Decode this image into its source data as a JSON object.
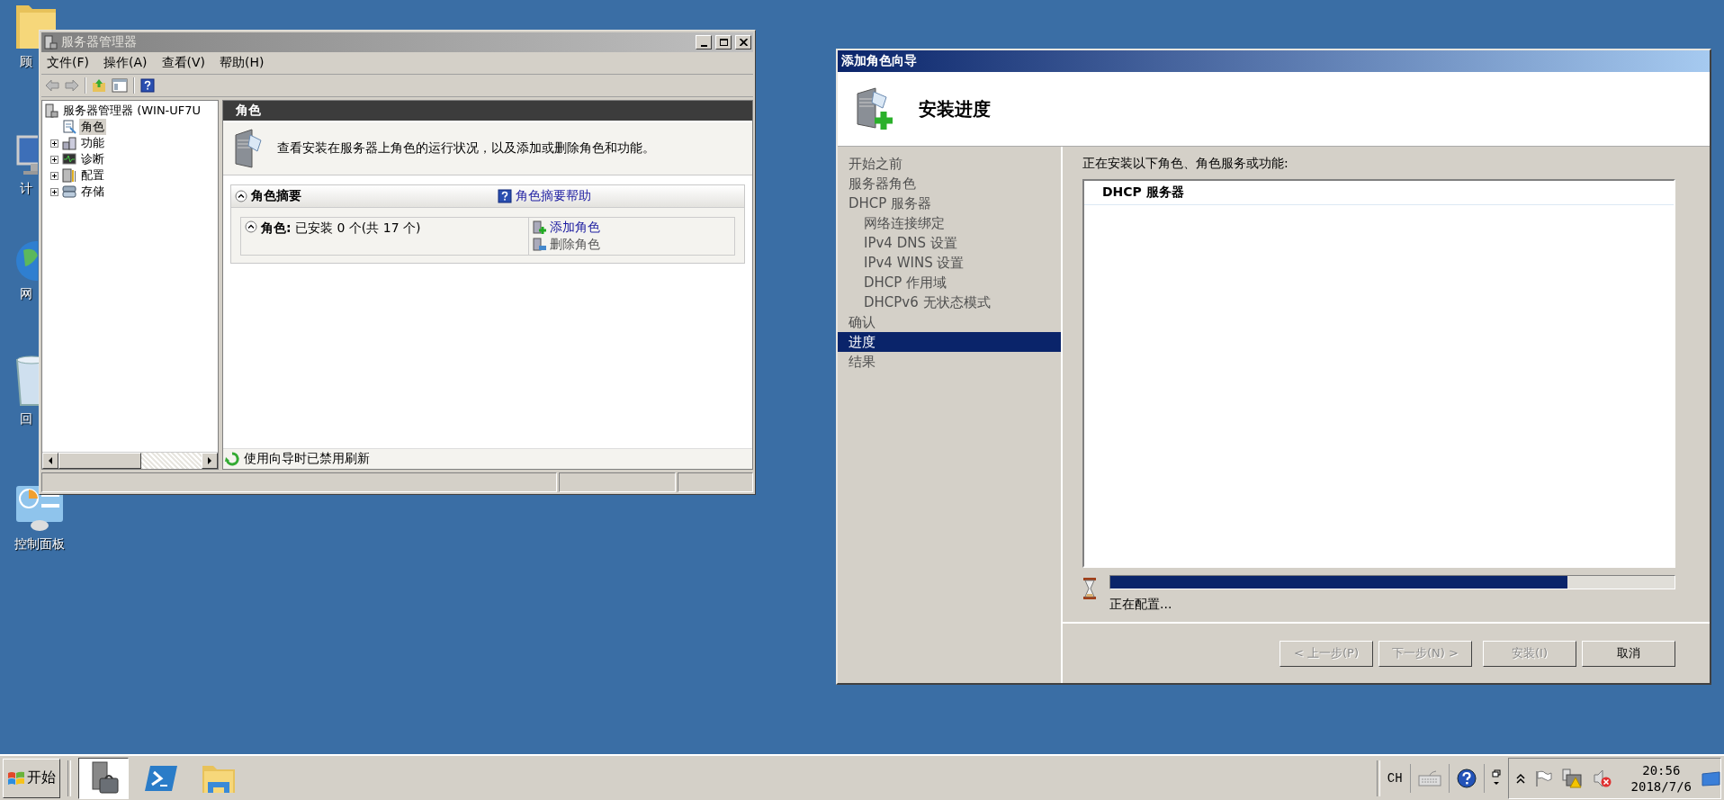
{
  "desktop_icons": [
    {
      "kind": "folder",
      "label": "顾"
    },
    {
      "kind": "computer",
      "label": "计"
    },
    {
      "kind": "network",
      "label": "网"
    },
    {
      "kind": "recycle-bin",
      "label": "回"
    },
    {
      "kind": "control-panel",
      "label": "控制面板"
    }
  ],
  "server_manager": {
    "title": "服务器管理器",
    "active": false,
    "menu": [
      "文件(F)",
      "操作(A)",
      "查看(V)",
      "帮助(H)"
    ],
    "tree": {
      "label": "服务器管理器 (WIN-UF7U",
      "children": [
        {
          "label": "角色",
          "selected": true,
          "has_children": false,
          "expanded": false
        },
        {
          "label": "功能",
          "selected": false,
          "has_children": true,
          "expanded": false
        },
        {
          "label": "诊断",
          "selected": false,
          "has_children": true,
          "expanded": false
        },
        {
          "label": "配置",
          "selected": false,
          "has_children": true,
          "expanded": false
        },
        {
          "label": "存储",
          "selected": false,
          "has_children": true,
          "expanded": false
        }
      ]
    },
    "pane_header": "角色",
    "description": "查看安装在服务器上角色的运行状况，以及添加或删除角色和功能。",
    "summary": {
      "title": "角色摘要",
      "help_link": "角色摘要帮助",
      "roles": "**角色:** 已安装 0 个(共 17 个)",
      "actions": [
        {
          "label": "添加角色",
          "disabled": false
        },
        {
          "label": "删除角色",
          "disabled": true
        }
      ]
    },
    "refresh_notice": "使用向导时已禁用刷新"
  },
  "wizard": {
    "title": "添加角色向导",
    "active": true,
    "heading": "安装进度",
    "steps": [
      {
        "label": "开始之前",
        "selected": false
      },
      {
        "label": "服务器角色",
        "selected": false
      },
      {
        "label": "DHCP 服务器",
        "selected": false,
        "children": [
          {
            "label": "网络连接绑定",
            "selected": false
          },
          {
            "label": "IPv4 DNS 设置",
            "selected": false
          },
          {
            "label": "IPv4 WINS 设置",
            "selected": false
          },
          {
            "label": "DHCP 作用域",
            "selected": false
          },
          {
            "label": "DHCPv6 无状态模式",
            "selected": false
          }
        ]
      },
      {
        "label": "确认",
        "selected": false
      },
      {
        "label": "进度",
        "selected": true
      },
      {
        "label": "结果",
        "selected": false
      }
    ],
    "intro": "正在安装以下角色、角色服务或功能:",
    "installing": [
      "DHCP 服务器"
    ],
    "progress": {
      "level": 0.81,
      "status": "正在配置..."
    },
    "buttons": [
      {
        "label": "< 上一步(P)",
        "disabled": true
      },
      {
        "label": "下一步(N) >",
        "disabled": true
      },
      {
        "label": "安装(I)",
        "disabled": true
      },
      {
        "label": "取消",
        "disabled": false
      }
    ]
  },
  "taskbar": {
    "start": "开始",
    "apps": [
      {
        "kind": "server-manager",
        "selected": true
      },
      {
        "kind": "powershell",
        "selected": false
      },
      {
        "kind": "explorer",
        "selected": false
      }
    ],
    "language": "CH",
    "time": "20:56",
    "date": "2018/7/6"
  }
}
